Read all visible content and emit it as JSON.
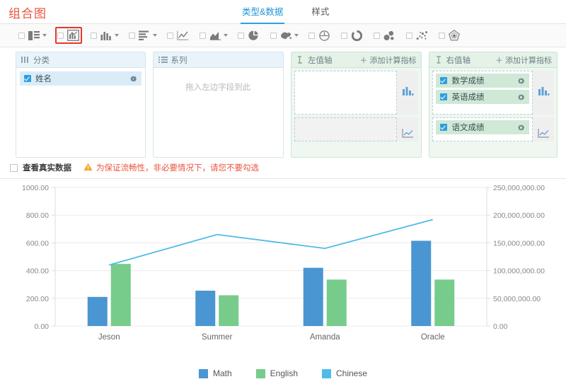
{
  "header": {
    "title": "组合图",
    "tabs": [
      {
        "label": "类型&数据",
        "active": true
      },
      {
        "label": "样式",
        "active": false
      }
    ]
  },
  "toolbar": {
    "items": [
      {
        "name": "combo-table-chart",
        "icon": "table-bar-icon",
        "checkbox": true,
        "caret": true,
        "selected": false
      },
      {
        "name": "combo-chart",
        "icon": "combo-bar-line-icon",
        "checkbox": true,
        "caret": false,
        "selected": true
      },
      {
        "name": "column-chart",
        "icon": "column-icon",
        "checkbox": true,
        "caret": true,
        "selected": false
      },
      {
        "name": "bar-chart",
        "icon": "bar-icon",
        "checkbox": true,
        "caret": true,
        "selected": false
      },
      {
        "name": "line-chart",
        "icon": "line-icon",
        "checkbox": true,
        "caret": false,
        "selected": false
      },
      {
        "name": "area-chart",
        "icon": "area-icon",
        "checkbox": true,
        "caret": true,
        "selected": false
      },
      {
        "name": "pie-chart",
        "icon": "pie-icon",
        "checkbox": true,
        "caret": false,
        "selected": false
      },
      {
        "name": "map-chart",
        "icon": "map-icon",
        "checkbox": true,
        "caret": true,
        "selected": false
      },
      {
        "name": "gauge-chart",
        "icon": "gauge-icon",
        "checkbox": true,
        "caret": false,
        "selected": false
      },
      {
        "name": "ring-chart",
        "icon": "ring-icon",
        "checkbox": true,
        "caret": false,
        "selected": false
      },
      {
        "name": "bubble-chart",
        "icon": "bubble-icon",
        "checkbox": true,
        "caret": false,
        "selected": false
      },
      {
        "name": "scatter-chart",
        "icon": "scatter-icon",
        "checkbox": true,
        "caret": false,
        "selected": false
      },
      {
        "name": "radar-chart",
        "icon": "radar-icon",
        "checkbox": true,
        "caret": false,
        "selected": false
      }
    ]
  },
  "panels": {
    "category": {
      "title": "分类",
      "icon": "category-columns-icon",
      "fields": [
        {
          "label": "姓名",
          "checked": true
        }
      ]
    },
    "series": {
      "title": "系列",
      "icon": "series-list-icon",
      "drop_hint": "拖入左边字段到此",
      "fields": []
    },
    "left_axis": {
      "title": "左值轴",
      "icon": "left-axis-icon",
      "add_label": "添加计算指标",
      "slots": [
        {
          "type": "column",
          "icon": "column-icon",
          "fields": []
        },
        {
          "type": "line",
          "icon": "line-icon",
          "fields": []
        }
      ]
    },
    "right_axis": {
      "title": "右值轴",
      "icon": "right-axis-icon",
      "add_label": "添加计算指标",
      "slots": [
        {
          "type": "column",
          "icon": "column-icon",
          "fields": [
            {
              "label": "数学成绩",
              "checked": true
            },
            {
              "label": "英语成绩",
              "checked": true
            }
          ]
        },
        {
          "type": "line",
          "icon": "line-icon",
          "fields": [
            {
              "label": "语文成绩",
              "checked": true
            }
          ]
        }
      ]
    }
  },
  "real_data": {
    "checkbox_label": "查看真实数据",
    "checked": false,
    "warning_icon": "warning-triangle-icon",
    "warning_text": "为保证流畅性，非必要情况下，请您不要勾选"
  },
  "colors": {
    "brand_red": "#e8543f",
    "tab_active": "#2196d4",
    "math": "#4a96d2",
    "english": "#77cc8b",
    "chinese": "#4fbbe8"
  },
  "chart_data": {
    "type": "bar",
    "title": "",
    "categories": [
      "Jeson",
      "Summer",
      "Amanda",
      "Oracle"
    ],
    "series": [
      {
        "name": "Math",
        "type": "bar",
        "axis": "left",
        "color": "#4a96d2",
        "values": [
          210,
          255,
          420,
          615
        ]
      },
      {
        "name": "English",
        "type": "bar",
        "axis": "left",
        "color": "#77cc8b",
        "values": [
          448,
          222,
          335,
          335
        ]
      },
      {
        "name": "Chinese",
        "type": "line",
        "axis": "right",
        "color": "#4fbbe8",
        "values": [
          110000000,
          165000000,
          140000000,
          192000000
        ]
      }
    ],
    "left_axis": {
      "ticks": [
        "0.00",
        "200.00",
        "400.00",
        "600.00",
        "800.00",
        "1000.00"
      ],
      "min": 0,
      "max": 1000
    },
    "right_axis": {
      "ticks": [
        "0.00",
        "50,000,000.00",
        "100,000,000.00",
        "150,000,000.00",
        "200,000,000.00",
        "250,000,000.00"
      ],
      "min": 0,
      "max": 250000000
    },
    "grid": true,
    "legend_position": "bottom",
    "legend": [
      "Math",
      "English",
      "Chinese"
    ]
  }
}
